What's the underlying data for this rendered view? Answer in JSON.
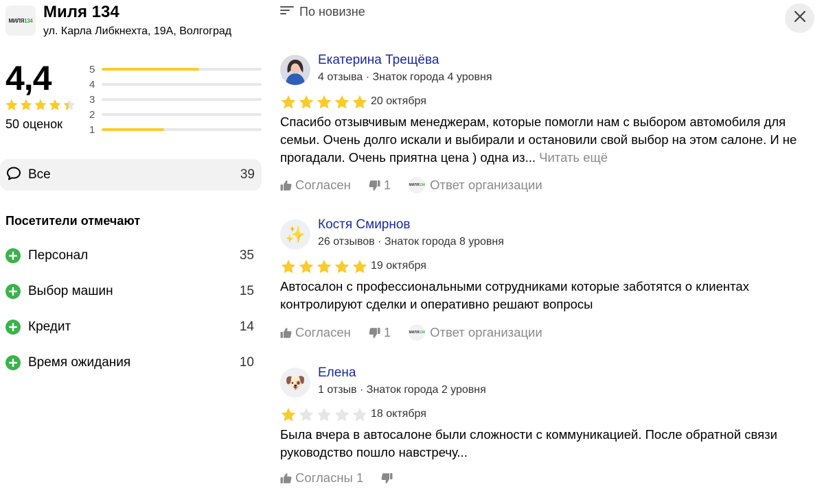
{
  "org": {
    "logo_text_a": "МИЛЯ",
    "logo_text_b": "134",
    "name": "Миля 134",
    "address": "ул. Карла Либкнехта, 19А, Волгоград"
  },
  "rating": {
    "value": "4,4",
    "count_label": "50 оценок",
    "star_fill": 4.4,
    "distribution": [
      {
        "label": "5",
        "fraction": 0.61
      },
      {
        "label": "4",
        "fraction": 0.0
      },
      {
        "label": "3",
        "fraction": 0.0
      },
      {
        "label": "2",
        "fraction": 0.0
      },
      {
        "label": "1",
        "fraction": 0.39
      }
    ]
  },
  "filter_all": {
    "label": "Все",
    "count": "39"
  },
  "visitors": {
    "title": "Посетители отмечают",
    "aspects": [
      {
        "label": "Персонал",
        "count": "35"
      },
      {
        "label": "Выбор машин",
        "count": "15"
      },
      {
        "label": "Кредит",
        "count": "14"
      },
      {
        "label": "Время ожидания",
        "count": "10"
      }
    ]
  },
  "sort": {
    "label": "По новизне"
  },
  "reviews": [
    {
      "author": "Екатерина Трещёва",
      "meta": "4 отзыва · Знаток города 4 уровня",
      "avatar": "photo",
      "stars": 5,
      "date": "20 октября",
      "text": "Спасибо отзывчивым менеджерам, которые помогли нам с выбором автомобиля для семьи. Очень долго искали и выбирали и остановили свой выбор на этом салоне. И не прогадали. Очень приятна цена ) одна из...",
      "more": "Читать ещё",
      "agree": "Согласен",
      "dislikes": "1",
      "org_answer": "Ответ организации"
    },
    {
      "author": "Костя Смирнов",
      "meta": "26 отзывов · Знаток города 8 уровня",
      "avatar": "✨",
      "stars": 5,
      "date": "19 октября",
      "text": "Автосалон с профессиональными сотрудниками которые заботятся о клиентах контролируют сделки и оперативно решают вопросы",
      "more": "",
      "agree": "Согласен",
      "dislikes": "1",
      "org_answer": "Ответ организации"
    },
    {
      "author": "Елена",
      "meta": "1 отзыв · Знаток города 2 уровня",
      "avatar": "🐶",
      "stars": 1,
      "date": "18 октября",
      "text": "Была вчера в автосалоне были сложности с коммуникацией. После обратной связи руководство пошло навстречу...",
      "more": "",
      "agree": "Согласны 1",
      "dislikes": "",
      "org_answer": ""
    }
  ],
  "colors": {
    "star": "#fbcb2c",
    "star_empty": "#e6e6e6",
    "author_link": "#1a2b9c",
    "positive": "#3bb34b",
    "muted": "#8a8a8a"
  }
}
